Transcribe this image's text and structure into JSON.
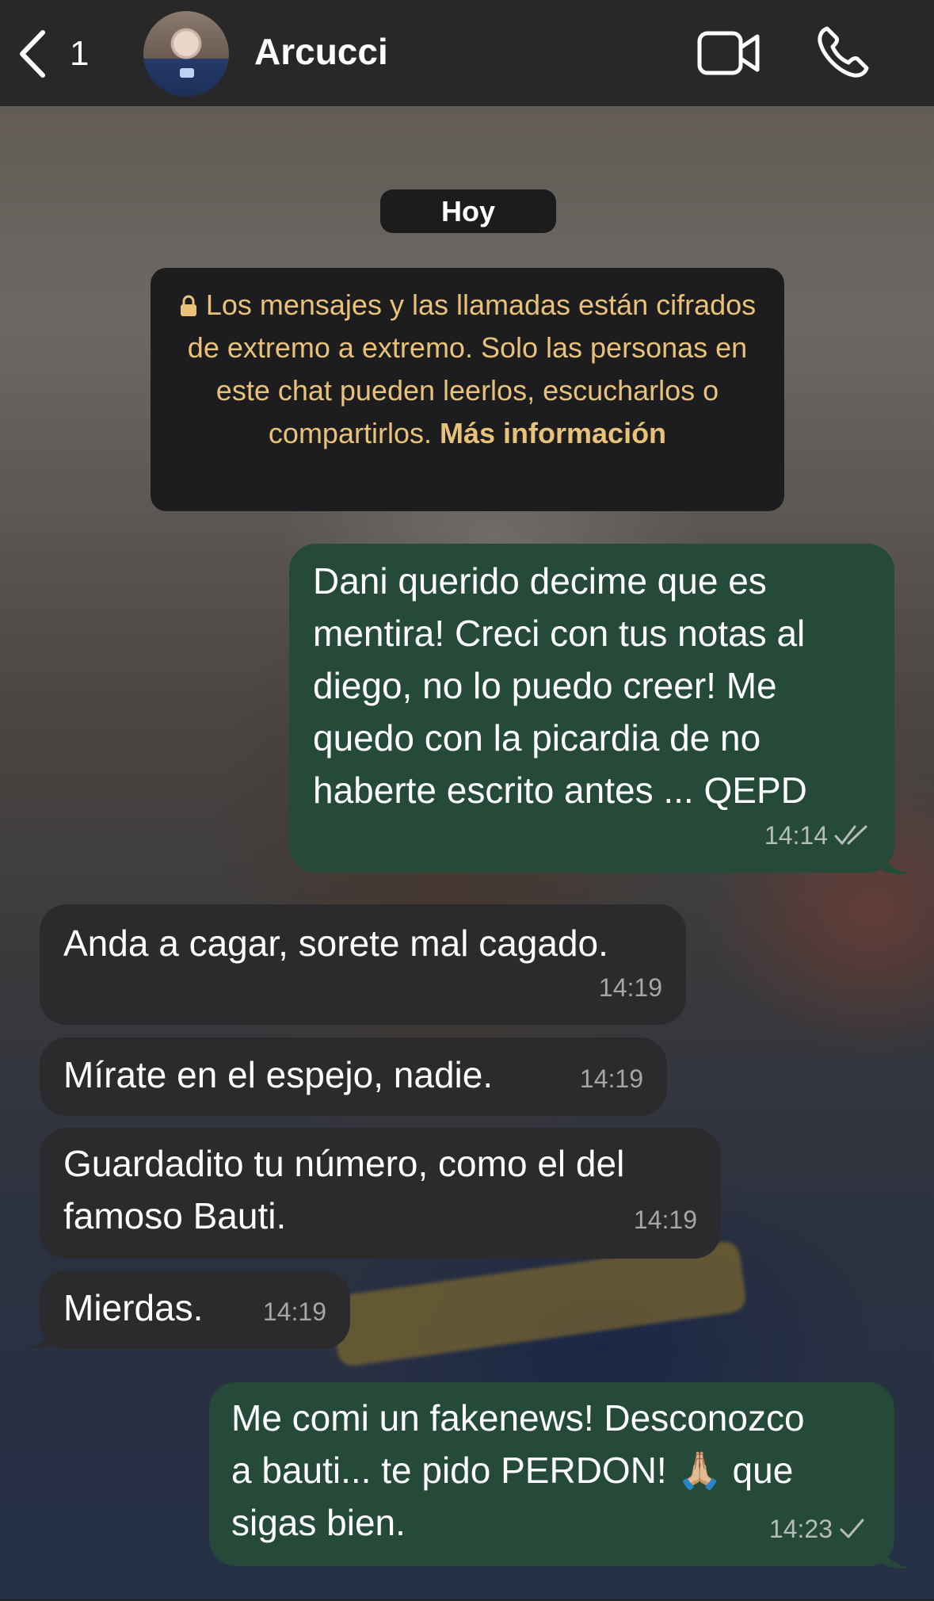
{
  "header": {
    "back_count": "1",
    "contact_name": "Arcucci"
  },
  "date_chip": "Hoy",
  "notice": {
    "text": "Los mensajes y las llamadas están cifrados de extremo a extremo. Solo las personas en este chat pueden leerlos, escucharlos o compartirlos.",
    "link": "Más información"
  },
  "messages": [
    {
      "direction": "out",
      "text": "Dani querido decime que es\nmentira! Creci con tus notas al\ndiego, no lo puedo creer! Me\nquedo con la picardia de no\nhaberte escrito antes ... QEPD",
      "time": "14:14",
      "status": "read"
    },
    {
      "direction": "in",
      "text": "Anda a cagar, sorete mal cagado.",
      "time": "14:19"
    },
    {
      "direction": "in",
      "text": "Mírate en el espejo, nadie.",
      "time": "14:19"
    },
    {
      "direction": "in",
      "text": "Guardadito tu número, como el del\nfamoso Bauti.",
      "time": "14:19"
    },
    {
      "direction": "in",
      "text": "Mierdas.",
      "time": "14:19"
    },
    {
      "direction": "out",
      "text": "Me comi un fakenews! Desconozco\na bauti... te pido PERDON! 🙏🏼 que\nsigas bien.",
      "time": "14:23",
      "status": "sent"
    }
  ],
  "colors": {
    "outgoing_bubble": "#254a3a",
    "incoming_bubble": "#2b2b2d",
    "notice_text": "#e9c27a"
  }
}
